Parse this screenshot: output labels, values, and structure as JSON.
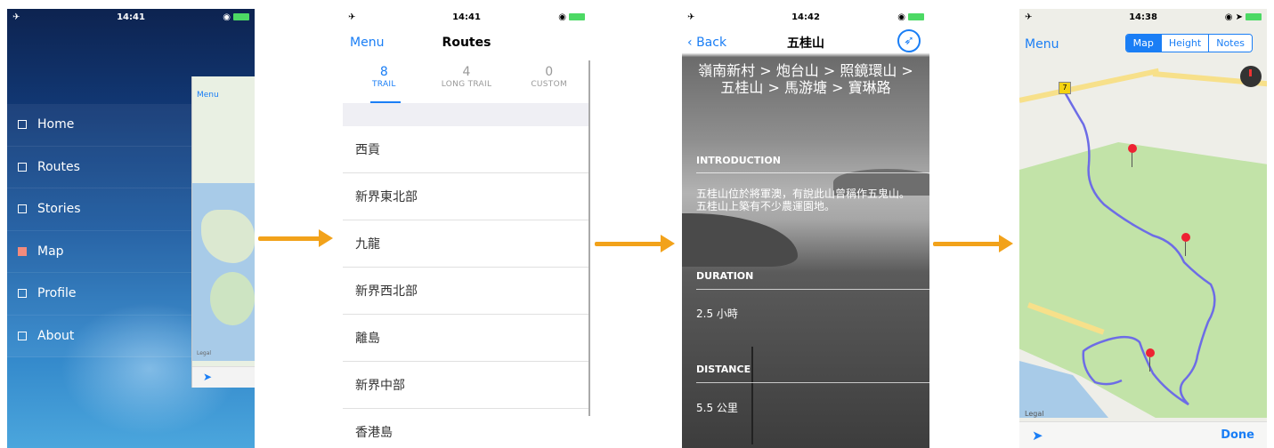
{
  "screen1": {
    "status_time": "14:41",
    "menu_items": [
      "Home",
      "Routes",
      "Stories",
      "Map",
      "Profile",
      "About"
    ],
    "active_item": "Map",
    "peek_menu_label": "Menu",
    "peek_legal": "Legal"
  },
  "screen2": {
    "status_time": "14:41",
    "nav_left": "Menu",
    "title": "Routes",
    "tabs": [
      {
        "count": "8",
        "label": "TRAIL"
      },
      {
        "count": "4",
        "label": "LONG TRAIL"
      },
      {
        "count": "0",
        "label": "CUSTOM"
      }
    ],
    "routes": [
      "西貢",
      "新界東北部",
      "九龍",
      "新界西北部",
      "離島",
      "新界中部",
      "香港島"
    ]
  },
  "screen3": {
    "status_time": "14:42",
    "back_label": "Back",
    "title": "五桂山",
    "route_path": "嶺南新村 > 炮台山 > 照鏡環山 > 五桂山 > 馬游塘 > 寶琳路",
    "introduction_heading": "INTRODUCTION",
    "introduction_text": "五桂山位於將軍澳，有說此山曾稱作五鬼山。五桂山上築有不少農運園地。",
    "duration_heading": "DURATION",
    "duration_value": "2.5 小時",
    "distance_heading": "DISTANCE",
    "distance_value": "5.5 公里"
  },
  "screen4": {
    "status_time": "14:38",
    "nav_left": "Menu",
    "segments": [
      "Map",
      "Height",
      "Notes"
    ],
    "active_segment": "Map",
    "legal": "Legal",
    "done_label": "Done"
  },
  "colors": {
    "accent": "#1a7ef5",
    "arrow": "#f2a21a",
    "menu_active": "#f28b7d"
  }
}
